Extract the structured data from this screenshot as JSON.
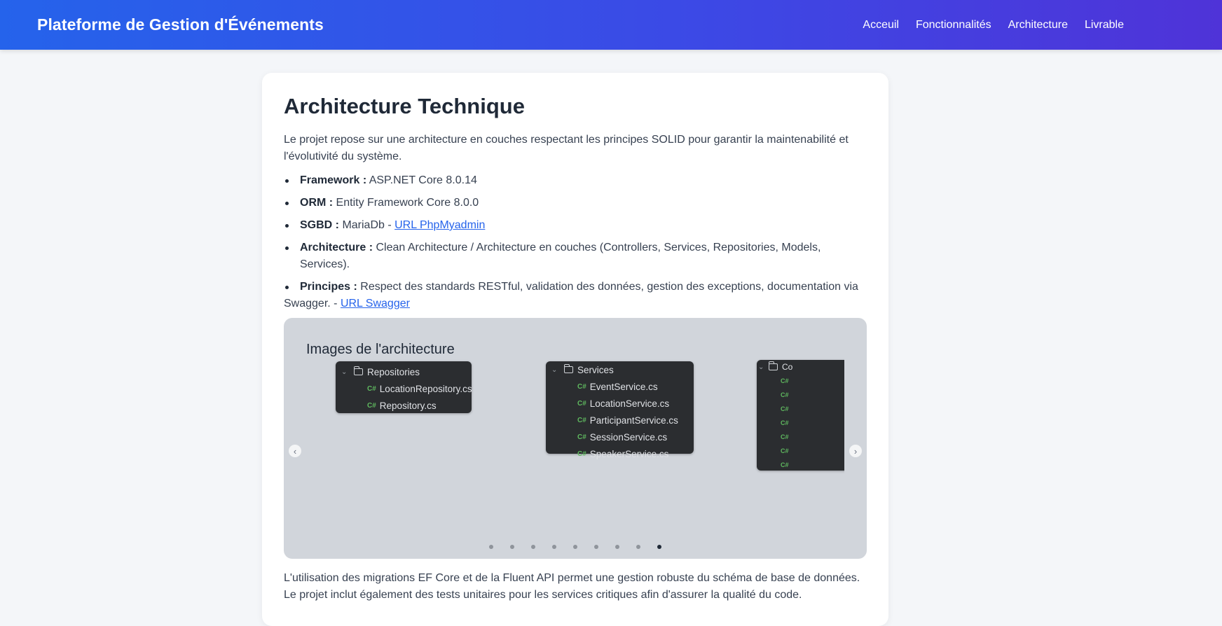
{
  "header": {
    "brand": "Plateforme de Gestion d'Événements",
    "nav": [
      "Acceuil",
      "Fonctionnalités",
      "Architecture",
      "Livrable"
    ]
  },
  "section": {
    "title": "Architecture Technique",
    "intro": "Le projet repose sur une architecture en couches respectant les principes SOLID pour garantir la maintenabilité et l'évolutivité du système.",
    "features": [
      {
        "label": "Framework :",
        "text": " ASP.NET Core 8.0.14"
      },
      {
        "label": "ORM :",
        "text": " Entity Framework Core 8.0.0"
      },
      {
        "label": "SGBD :",
        "text": " MariaDb - ",
        "link": "URL PhpMyadmin"
      },
      {
        "label": "Architecture :",
        "text": " Clean Architecture / Architecture en couches (Controllers, Services, Repositories, Models, Services)."
      },
      {
        "label": "Principes :",
        "text": " Respect des standards RESTful, validation des données, gestion des exceptions, documentation via Swagger. - ",
        "link": "URL Swagger"
      }
    ],
    "outro": "L'utilisation des migrations EF Core et de la Fluent API permet une gestion robuste du schéma de base de données. Le projet inclut également des tests unitaires pour les services critiques afin d'assurer la qualité du code."
  },
  "carousel": {
    "title": "Images de l'architecture",
    "prev_icon": "chevron-left-icon",
    "next_icon": "chevron-right-icon",
    "slides": [
      {
        "folder": "Repositories",
        "files": [
          "LocationRepository.cs",
          "Repository.cs"
        ]
      },
      {
        "folder": "Services",
        "files": [
          "EventService.cs",
          "LocationService.cs",
          "ParticipantService.cs",
          "SessionService.cs",
          "SpeakerService.cs"
        ]
      },
      {
        "folder": "Co",
        "files": [
          "",
          "",
          "",
          "",
          "",
          "",
          ""
        ]
      }
    ],
    "dot_count": 9,
    "active_dot": 9
  },
  "colors": {
    "header_gradient_start": "#2563eb",
    "header_gradient_end": "#4f33d8",
    "link": "#2563eb",
    "carousel_bg": "#d1d5db",
    "ide_bg": "#2b2d30",
    "cs_icon": "#5fb85f"
  }
}
